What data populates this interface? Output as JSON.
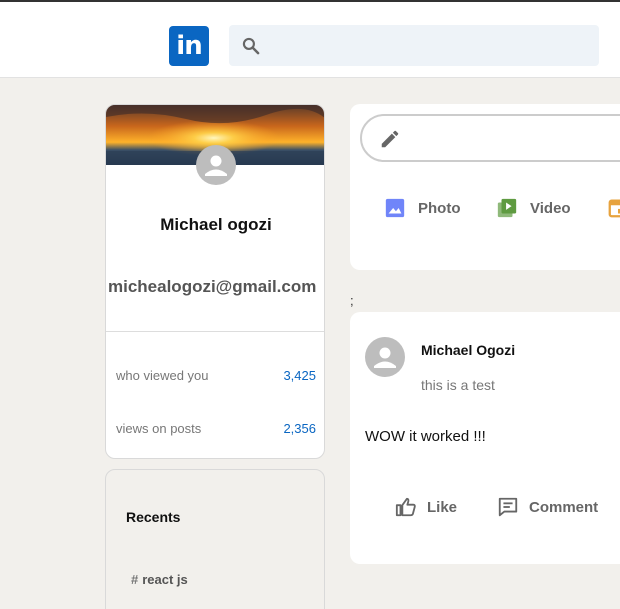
{
  "header": {
    "logo_text": "in",
    "search": {
      "placeholder": "",
      "value": ""
    },
    "brand_color": "#0a66c2"
  },
  "sidebar": {
    "profile": {
      "name": "Michael ogozi",
      "email": "michealogozi@gmail.com",
      "avatar_icon": "person-avatar-icon",
      "cover_image": "sunset-over-sea"
    },
    "stats": [
      {
        "label": "who viewed you",
        "value": "3,425"
      },
      {
        "label": "views on posts",
        "value": "2,356"
      }
    ],
    "recents": {
      "title": "Recents",
      "items": [
        {
          "hash": "#",
          "label": "react js"
        }
      ]
    }
  },
  "share_box": {
    "input_icon": "pencil-icon",
    "actions": [
      {
        "label": "Photo",
        "icon": "image-icon",
        "color": "#7085f9"
      },
      {
        "label": "Video",
        "icon": "video-icon",
        "color": "#5f9b41"
      },
      {
        "label": "",
        "icon": "calendar-icon",
        "color": "#e7a33e"
      }
    ]
  },
  "stray_text": ";",
  "posts": [
    {
      "author": "Michael Ogozi",
      "subtitle": "this is a test",
      "body": "WOW it worked !!!",
      "actions": [
        {
          "label": "Like",
          "icon": "thumbs-up-icon"
        },
        {
          "label": "Comment",
          "icon": "comment-icon"
        }
      ]
    }
  ]
}
